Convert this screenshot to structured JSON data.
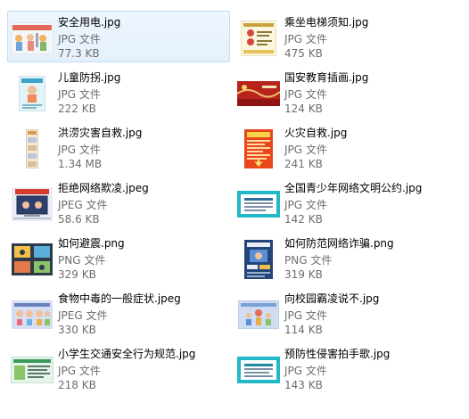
{
  "files": [
    {
      "name": "安全用电.jpg",
      "type": "JPG 文件",
      "size": "77.3 KB",
      "selected": true,
      "thumb": "safety-electricity-poster-thumbnail"
    },
    {
      "name": "乘坐电梯须知.jpg",
      "type": "JPG 文件",
      "size": "475 KB",
      "selected": false,
      "thumb": "elevator-notice-thumbnail"
    },
    {
      "name": "儿童防拐.jpg",
      "type": "JPG 文件",
      "size": "222 KB",
      "selected": false,
      "thumb": "child-anti-abduction-thumbnail"
    },
    {
      "name": "国安教育插画.jpg",
      "type": "JPG 文件",
      "size": "124 KB",
      "selected": false,
      "thumb": "national-security-banner-thumbnail"
    },
    {
      "name": "洪涝灾害自救.jpg",
      "type": "JPG 文件",
      "size": "1.34 MB",
      "selected": false,
      "thumb": "flood-self-rescue-thumbnail"
    },
    {
      "name": "火灾自救.jpg",
      "type": "JPG 文件",
      "size": "241 KB",
      "selected": false,
      "thumb": "fire-self-rescue-thumbnail"
    },
    {
      "name": "拒绝网络欺凌.jpeg",
      "type": "JPEG 文件",
      "size": "58.6 KB",
      "selected": false,
      "thumb": "cyberbullying-thumbnail"
    },
    {
      "name": "全国青少年网络文明公约.jpg",
      "type": "JPG 文件",
      "size": "142 KB",
      "selected": false,
      "thumb": "network-convention-thumbnail"
    },
    {
      "name": "如何避震.png",
      "type": "PNG 文件",
      "size": "329 KB",
      "selected": false,
      "thumb": "earthquake-thumbnail"
    },
    {
      "name": "如何防范网络诈骗.png",
      "type": "PNG 文件",
      "size": "319 KB",
      "selected": false,
      "thumb": "online-fraud-thumbnail"
    },
    {
      "name": "食物中毒的一般症状.jpeg",
      "type": "JPEG 文件",
      "size": "330 KB",
      "selected": false,
      "thumb": "food-poisoning-thumbnail"
    },
    {
      "name": "向校园霸凌说不.jpg",
      "type": "JPG 文件",
      "size": "114 KB",
      "selected": false,
      "thumb": "school-bullying-thumbnail"
    },
    {
      "name": "小学生交通安全行为规范.jpg",
      "type": "JPG 文件",
      "size": "218 KB",
      "selected": false,
      "thumb": "traffic-safety-thumbnail"
    },
    {
      "name": "预防性侵害拍手歌.jpg",
      "type": "JPG 文件",
      "size": "143 KB",
      "selected": false,
      "thumb": "prevention-song-thumbnail"
    }
  ],
  "colors": {
    "selection_bg": "#e4f0fc",
    "selection_border": "#c3dcf4",
    "meta_text": "#6d6d6d"
  }
}
